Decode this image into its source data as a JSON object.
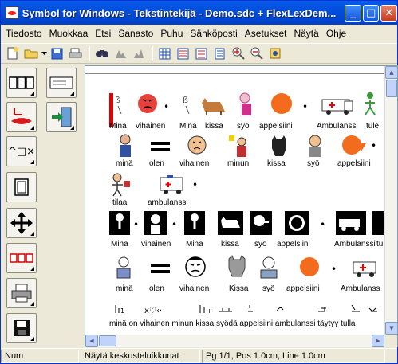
{
  "window": {
    "title": "Symbol for Windows - Tekstintekijä - Demo.sdc + FlexLexDem..."
  },
  "caption_buttons": {
    "minimize": "_",
    "maximize": "□",
    "close": "✕"
  },
  "menu": [
    "Tiedosto",
    "Muokkaa",
    "Etsi",
    "Sanasto",
    "Puhu",
    "Sähköposti",
    "Asetukset",
    "Näytä",
    "Ohje"
  ],
  "toolbar_icons": [
    "new-document-icon",
    "open-folder-icon",
    "dropdown-arrow-icon",
    "save-icon",
    "print-icon",
    "find-icon",
    "symbol-left-icon",
    "symbol-right-icon",
    "layout-table-icon",
    "layout-columns-icon",
    "layout-rows-icon",
    "layout-page-icon",
    "zoom-in-icon",
    "zoom-out-icon",
    "settings-icon"
  ],
  "left_tools": [
    "grid-frames-tool",
    "text-box-tool",
    "mouth-speak-tool",
    "exit-door-tool",
    "symbol-shapes-tool",
    "frame-tool",
    "move-arrows-tool",
    "sequence-tool",
    "printer-tool",
    "save-tool"
  ],
  "doc": {
    "line1": [
      "Minä",
      "vihainen",
      "Minä",
      "kissa",
      "syö",
      "appelsiini",
      "Ambulanssi",
      "tule"
    ],
    "line2": [
      "minä",
      "olen",
      "vihainen",
      "minun",
      "kissa",
      "syö",
      "appelsiini"
    ],
    "line3": [
      "tilaa",
      "ambulanssi"
    ],
    "line4": [
      "Minä",
      "vihainen",
      "Minä",
      "kissa",
      "syö",
      "appelsiini",
      "Ambulanssi",
      "tu"
    ],
    "line5": [
      "minä",
      "olen",
      "vihainen",
      "Kissa",
      "syö",
      "appelsiini",
      "Ambulanss"
    ],
    "line6": "minä on vihainen    minun kissa syödä appelsiini ambulanssi täytyy tulla"
  },
  "status": {
    "mode": "Num",
    "panels": "Näytä keskusteluikkunat",
    "position": "Pg 1/1, Pos 1.0cm, Line 1.0cm"
  },
  "colors": {
    "titlebar": "#0054e3",
    "cursor": "#e00000",
    "orange": "#f36b1c",
    "face": "#e6423a"
  }
}
